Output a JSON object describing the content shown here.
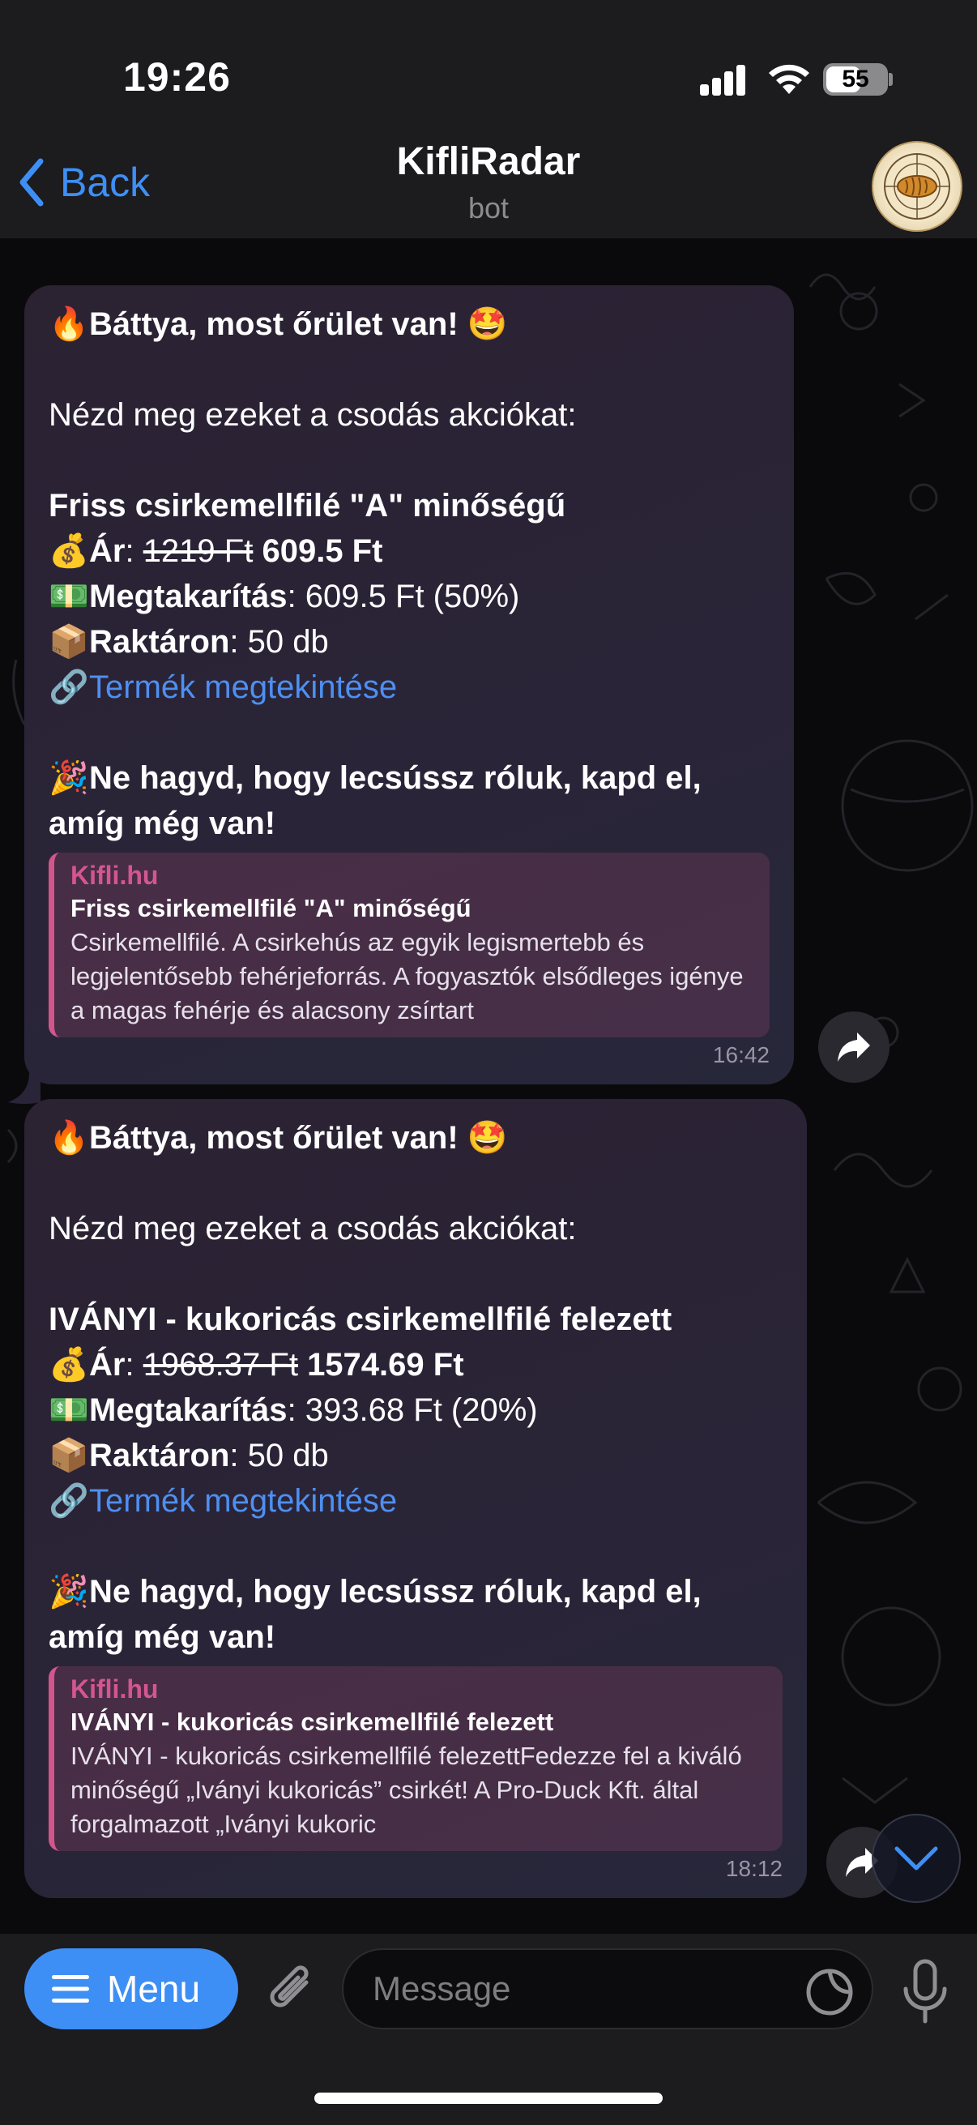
{
  "status_bar": {
    "time": "19:26",
    "battery": "55"
  },
  "header": {
    "back_label": "Back",
    "title": "KifliRadar",
    "subtitle": "bot"
  },
  "messages": [
    {
      "headline": "Báttya, most őrület van!",
      "intro": "Nézd meg ezeket a csodás akciókat:",
      "product": "Friss csirkemellfilé \"A\" minőségű",
      "price_label": "Ár",
      "old_price": "1219 Ft",
      "new_price": "609.5 Ft",
      "savings_label": "Megtakarítás",
      "savings_value": "609.5 Ft (50%)",
      "stock_label": "Raktáron",
      "stock_value": "50 db",
      "link_label": "Termék megtekintése",
      "cta_line1": "Ne hagyd, hogy lecsússz róluk, kapd el,",
      "cta_line2": "amíg még van!",
      "preview": {
        "site": "Kifli.hu",
        "title": "Friss csirkemellfilé \"A\" minőségű",
        "description": "Csirkemellfilé. A csirkehús az egyik legismertebb és legjelentősebb fehérjeforrás. A fogyasztók elsődleges igénye a magas fehérje és alacsony zsírtart"
      },
      "time": "16:42"
    },
    {
      "headline": "Báttya, most őrület van!",
      "intro": "Nézd meg ezeket a csodás akciókat:",
      "product": "IVÁNYI - kukoricás csirkemellfilé felezett",
      "price_label": "Ár",
      "old_price": "1968.37 Ft",
      "new_price": "1574.69 Ft",
      "savings_label": "Megtakarítás",
      "savings_value": "393.68 Ft (20%)",
      "stock_label": "Raktáron",
      "stock_value": "50 db",
      "link_label": "Termék megtekintése",
      "cta_line1": "Ne hagyd, hogy lecsússz róluk, kapd el,",
      "cta_line2": "amíg még van!",
      "preview": {
        "site": "Kifli.hu",
        "title": "IVÁNYI - kukoricás csirkemellfilé felezett",
        "description": "IVÁNYI - kukoricás csirkemellfilé felezettFedezze fel a kiváló minőségű „Iványi kukoricás” csirkét! A Pro-Duck Kft. által forgalmazott „Iványi kukoric"
      },
      "time": "18:12"
    }
  ],
  "composer": {
    "menu_label": "Menu",
    "placeholder": "Message"
  },
  "colors": {
    "accent": "#3e8ff5",
    "link": "#4e8ff1",
    "preview_bar": "#d2568c"
  }
}
